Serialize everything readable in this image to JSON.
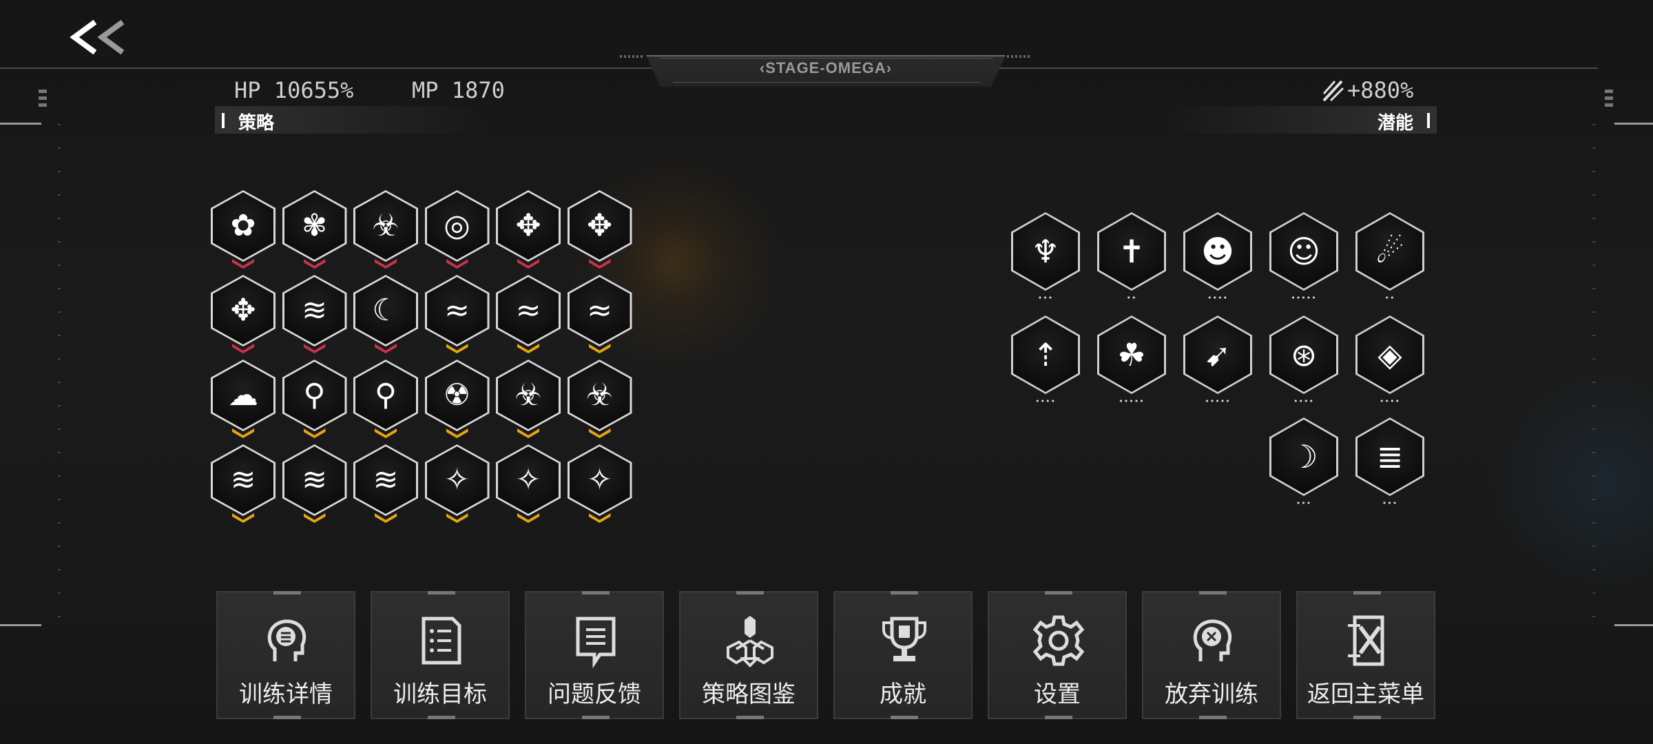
{
  "header": {
    "stage_title": "‹STAGE-OMEGA›",
    "back_icon": "double-chevron-left-icon"
  },
  "stats": {
    "hp": "HP 10655%",
    "mp": "MP 1870",
    "bonus": "+880%",
    "bonus_icon": "slash-burst-icon"
  },
  "sections": {
    "strategy": "策略",
    "potential": "潜能"
  },
  "colors": {
    "red_rank": "#c8324a",
    "gold_rank": "#e8a513"
  },
  "strategy_icons": [
    {
      "icon": "drop-cluster-icon",
      "glyph": "✿",
      "rank": "red"
    },
    {
      "icon": "flower-icon",
      "glyph": "✾",
      "rank": "red"
    },
    {
      "icon": "biohazard-icon",
      "glyph": "☣",
      "rank": "red"
    },
    {
      "icon": "orbit-target-icon",
      "glyph": "◎",
      "rank": "red"
    },
    {
      "icon": "crosshair-wind-icon",
      "glyph": "✥",
      "rank": "red"
    },
    {
      "icon": "crosshair-wind-alt-icon",
      "glyph": "✥",
      "rank": "red"
    },
    {
      "icon": "crosshair-burst-icon",
      "glyph": "✥",
      "rank": "red"
    },
    {
      "icon": "claw-slash-icon",
      "glyph": "≋",
      "rank": "red"
    },
    {
      "icon": "crescent-swirl-icon",
      "glyph": "☾",
      "rank": "red"
    },
    {
      "icon": "feather-blades-icon",
      "glyph": "≈",
      "rank": "gold"
    },
    {
      "icon": "feather-blades-up-icon",
      "glyph": "≈",
      "rank": "gold"
    },
    {
      "icon": "feather-blades-plus-icon",
      "glyph": "≈",
      "rank": "gold"
    },
    {
      "icon": "storm-cloud-icon",
      "glyph": "☁",
      "rank": "gold"
    },
    {
      "icon": "chain-node-plus-icon",
      "glyph": "⚲",
      "rank": "gold"
    },
    {
      "icon": "chain-node-icon",
      "glyph": "⚲",
      "rank": "gold"
    },
    {
      "icon": "radiation-ring-icon",
      "glyph": "☢",
      "rank": "gold"
    },
    {
      "icon": "biohazard-ring-icon",
      "glyph": "☣",
      "rank": "gold"
    },
    {
      "icon": "biohazard-forward-icon",
      "glyph": "☣",
      "rank": "gold"
    },
    {
      "icon": "claw-strike-icon",
      "glyph": "≋",
      "rank": "gold"
    },
    {
      "icon": "claw-strike-arrow-icon",
      "glyph": "≋",
      "rank": "gold"
    },
    {
      "icon": "claw-strike-orb-icon",
      "glyph": "≋",
      "rank": "gold"
    },
    {
      "icon": "crosshair-star-icon",
      "glyph": "✧",
      "rank": "gold"
    },
    {
      "icon": "crosshair-star-plus-icon",
      "glyph": "✧",
      "rank": "gold"
    },
    {
      "icon": "crosshair-star-bars-icon",
      "glyph": "✧",
      "rank": "gold"
    }
  ],
  "potential_icons": [
    {
      "icon": "demon-wings-icon",
      "glyph": "♆",
      "pips": "•••"
    },
    {
      "icon": "tombstone-cross-icon",
      "glyph": "✝",
      "pips": "••"
    },
    {
      "icon": "pumpkin-icon",
      "glyph": "☻",
      "pips": "••••"
    },
    {
      "icon": "grinning-mask-icon",
      "glyph": "☺",
      "pips": "•••••"
    },
    {
      "icon": "dragon-wind-icon",
      "glyph": "☄",
      "pips": "••"
    },
    {
      "icon": "boot-jump-icon",
      "glyph": "⇡",
      "pips": "••••"
    },
    {
      "icon": "toad-icon",
      "glyph": "☘",
      "pips": "•••••"
    },
    {
      "icon": "sprinter-icon",
      "glyph": "➹",
      "pips": "•••••"
    },
    {
      "icon": "compass-eye-icon",
      "glyph": "⊛",
      "pips": "••••"
    },
    {
      "icon": "diamond-vortex-icon",
      "glyph": "◈",
      "pips": "••••"
    },
    {
      "icon": "crescent-crest-icon",
      "glyph": "☽",
      "pips": "•••"
    },
    {
      "icon": "shattered-wood-icon",
      "glyph": "≣",
      "pips": "•••"
    }
  ],
  "menu": [
    {
      "label": "训练详情",
      "icon": "head-list-icon"
    },
    {
      "label": "训练目标",
      "icon": "document-list-icon"
    },
    {
      "label": "问题反馈",
      "icon": "feedback-note-icon"
    },
    {
      "label": "策略图鉴",
      "icon": "strategy-nodes-icon"
    },
    {
      "label": "成就",
      "icon": "trophy-icon"
    },
    {
      "label": "设置",
      "icon": "gear-icon"
    },
    {
      "label": "放弃训练",
      "icon": "head-x-icon"
    },
    {
      "label": "返回主菜单",
      "icon": "exit-door-icon"
    }
  ]
}
